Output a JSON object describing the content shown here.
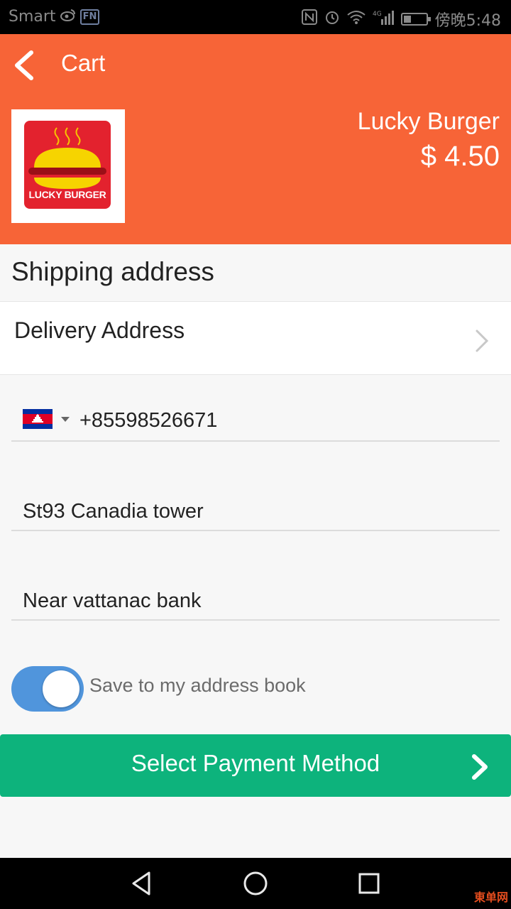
{
  "status_bar": {
    "carrier": "Smart",
    "app_icons": [
      "weibo-icon",
      "fn-icon"
    ],
    "fn_label": "FN",
    "network": "4G",
    "time": "傍晚5:48"
  },
  "header": {
    "title": "Cart",
    "shop_name": "Lucky Burger",
    "price": "$ 4.50",
    "logo_text": "LUCKY BURGER",
    "accent_color": "#f76437"
  },
  "shipping": {
    "section_title": "Shipping address",
    "delivery_label": "Delivery Address"
  },
  "form": {
    "country_flag": "cambodia-flag-icon",
    "phone": "+85598526671",
    "street": "St93 Canadia tower",
    "landmark": "Near vattanac bank",
    "save_toggle": {
      "checked": true,
      "label": "Save to my address book",
      "color": "#5095dc"
    }
  },
  "payment": {
    "button_label": "Select Payment Method",
    "button_color": "#0db37c"
  },
  "nav_bar": {
    "icons": [
      "back-triangle-icon",
      "home-circle-icon",
      "recent-square-icon"
    ]
  },
  "watermark": "東单网"
}
